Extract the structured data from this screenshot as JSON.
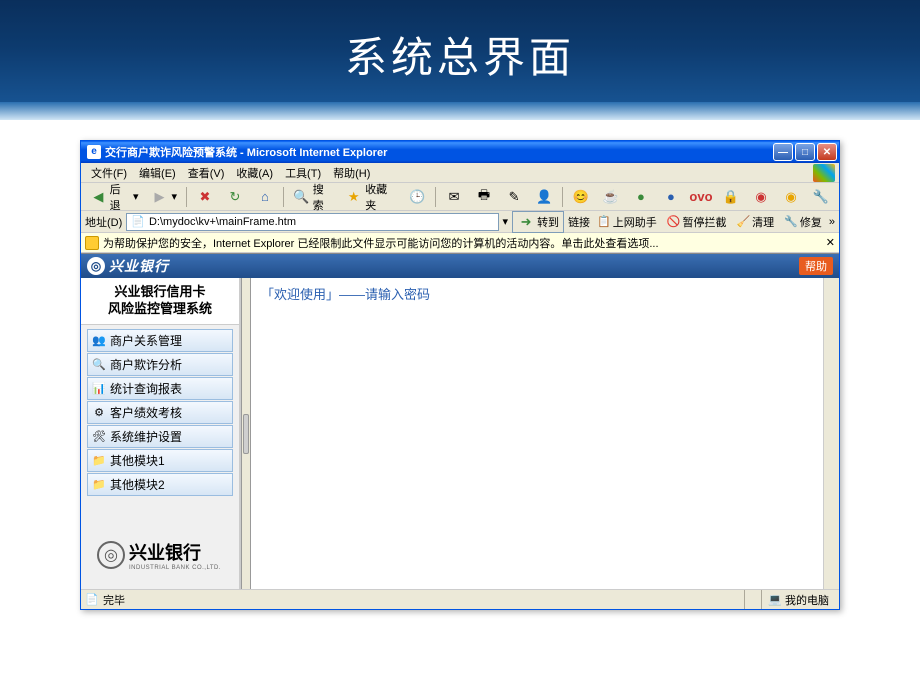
{
  "slide": {
    "title": "系统总界面"
  },
  "window": {
    "title": "交行商户欺诈风险预警系统 - Microsoft Internet Explorer",
    "menu": {
      "file": "文件(F)",
      "edit": "编辑(E)",
      "view": "查看(V)",
      "favorites": "收藏(A)",
      "tools": "工具(T)",
      "help": "帮助(H)"
    },
    "toolbar": {
      "back": "后退",
      "search": "搜索",
      "favorites": "收藏夹"
    },
    "address": {
      "label": "地址(D)",
      "value": "D:\\mydoc\\kv+\\mainFrame.htm",
      "go": "转到",
      "links_label": "链接",
      "link1": "上网助手",
      "link2": "暂停拦截",
      "link3": "清理",
      "link4": "修复"
    },
    "infobar": "为帮助保护您的安全，Internet Explorer 已经限制此文件显示可能访问您的计算机的活动内容。单击此处查看选项..."
  },
  "app": {
    "bank_name": "兴业银行",
    "help": "帮助",
    "sidebar_title_1": "兴业银行信用卡",
    "sidebar_title_2": "风险监控管理系统",
    "menu_items": [
      {
        "icon": "👥",
        "label": "商户关系管理"
      },
      {
        "icon": "🔍",
        "label": "商户欺诈分析"
      },
      {
        "icon": "📊",
        "label": "统计查询报表"
      },
      {
        "icon": "⚙",
        "label": "客户绩效考核"
      },
      {
        "icon": "🛠",
        "label": "系统维护设置"
      },
      {
        "icon": "📁",
        "label": "其他模块1"
      },
      {
        "icon": "📁",
        "label": "其他模块2"
      }
    ],
    "welcome": "「欢迎使用」——请输入密码",
    "footer_bank": "兴业银行",
    "footer_sub": "INDUSTRIAL BANK CO.,LTD."
  },
  "status": {
    "done": "完毕",
    "zone": "我的电脑"
  }
}
